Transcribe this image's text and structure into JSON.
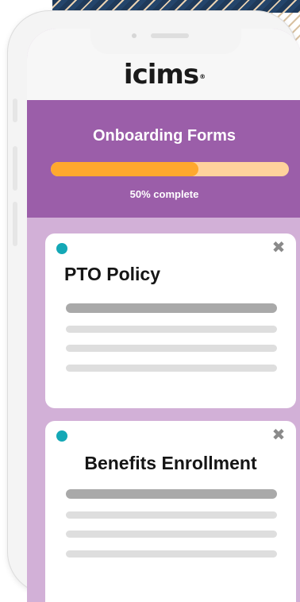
{
  "app": {
    "logo_text": "icims",
    "logo_mark": "®"
  },
  "header": {
    "title": "Onboarding Forms",
    "progress_label": "50% complete",
    "progress_fraction": 0.62
  },
  "cards": [
    {
      "title": "PTO Policy",
      "icon": "close-icon",
      "status_color": "#14a8b6"
    },
    {
      "title": "Benefits Enrollment",
      "icon": "close-icon",
      "status_color": "#14a8b6"
    }
  ],
  "colors": {
    "brand_purple": "#9b5ea9",
    "page_lilac": "#d2b0d7",
    "progress_fill": "#ffa82e",
    "progress_track": "#ffd29c",
    "status_teal": "#14a8b6"
  }
}
